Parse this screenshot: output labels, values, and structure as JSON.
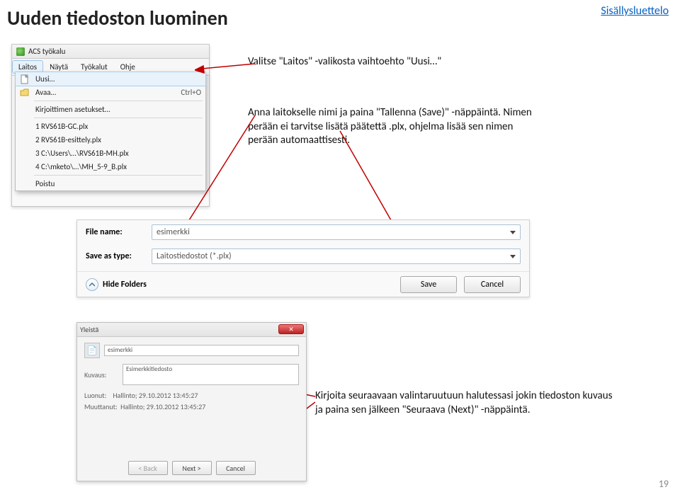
{
  "page": {
    "title": "Uuden tiedoston luominen",
    "toc_link": "Sisällysluettelo",
    "page_number": "19"
  },
  "instructions": {
    "step1": "Valitse \"Laitos\" -valikosta vaihtoehto \"Uusi…\"",
    "step2": "Anna laitokselle nimi ja paina \"Tallenna (Save)\" -näppäintä. Nimen perään ei tarvitse lisätä päätettä .plx, ohjelma lisää sen nimen perään automaattisesti.",
    "step3": "Kirjoita seuraavaan valintaruutuun halutessasi jokin tiedoston kuvaus ja paina sen jälkeen \"Seuraava (Next)\" -näppäintä."
  },
  "menu_shot": {
    "app_title": "ACS työkalu",
    "menubar": {
      "laitos": "Laitos",
      "nayta": "Näytä",
      "tyokalut": "Työkalut",
      "ohje": "Ohje"
    },
    "items": {
      "uusi": "Uusi…",
      "avaa": "Avaa…",
      "avaa_shortcut": "Ctrl+O",
      "kirjoittimen": "Kirjoittimen asetukset…",
      "recent1": "1 RVS61B-GC.plx",
      "recent2": "2 RVS61B-esittely.plx",
      "recent3": "3 C:\\Users\\…\\RVS61B-MH.plx",
      "recent4": "4 C:\\mketo\\…\\MH_5-9_B.plx",
      "poistu": "Poistu"
    }
  },
  "save_shot": {
    "filename_label": "File name:",
    "filename_value": "esimerkki",
    "saveas_label": "Save as type:",
    "saveas_value": "Laitostiedostot (*.plx)",
    "hide_folders": "Hide Folders",
    "save_btn": "Save",
    "cancel_btn": "Cancel"
  },
  "info_shot": {
    "title": "Yleistä",
    "name_value": "esimerkki",
    "kuvaus_label": "Kuvaus:",
    "kuvaus_value": "Esimerkkitiedosto",
    "luonut_label": "Luonut:",
    "luonut_value": "Hallinto; 29.10.2012 13:45:27",
    "muuttanut_label": "Muuttanut:",
    "muuttanut_value": "Hallinto; 29.10.2012 13:45:27",
    "back_btn": "< Back",
    "next_btn": "Next >",
    "cancel_btn": "Cancel"
  }
}
